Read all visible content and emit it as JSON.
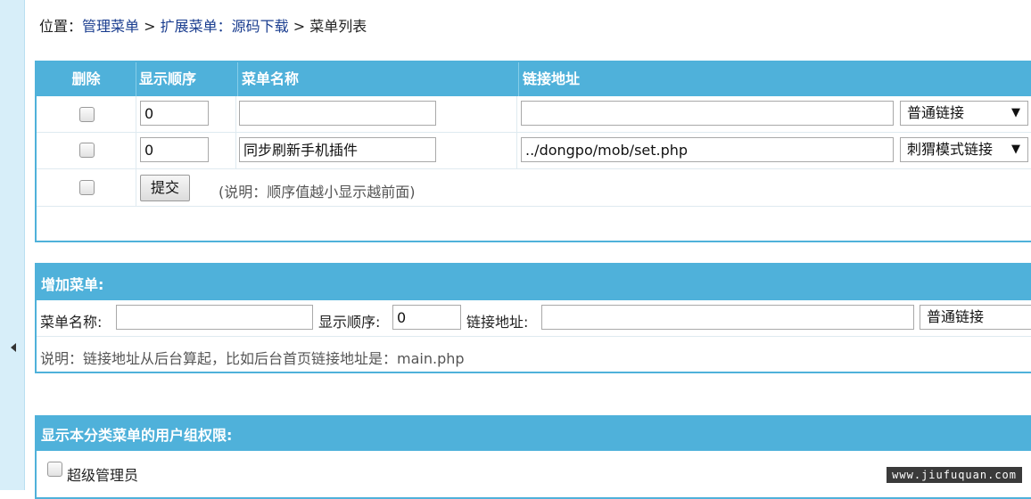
{
  "breadcrumb": {
    "prefix": "位置：",
    "item1": "管理菜单",
    "sep1": " > ",
    "item2": "扩展菜单：源码下载",
    "sep2": " > ",
    "current": "菜单列表"
  },
  "menu_table": {
    "headers": {
      "delete": "删除",
      "order": "显示顺序",
      "name": "菜单名称",
      "link": "链接地址"
    },
    "rows": [
      {
        "order": "0",
        "name": "",
        "link": "",
        "type": "普通链接"
      },
      {
        "order": "0",
        "name": "同步刷新手机插件",
        "link": "../dongpo/mob/set.php",
        "type": "刺猬模式链接"
      }
    ],
    "submit_label": "提交",
    "note": "(说明：顺序值越小显示越前面)"
  },
  "add_menu": {
    "title": "增加菜单:",
    "name_label": "菜单名称:",
    "name_value": "",
    "order_label": "显示顺序:",
    "order_value": "0",
    "link_label": "链接地址:",
    "link_value": "",
    "type_value": "普通链接",
    "note": "说明：链接地址从后台算起，比如后台首页链接地址是：main.php"
  },
  "permissions": {
    "title": "显示本分类菜单的用户组权限:",
    "groups": [
      {
        "label": "超级管理员",
        "checked": false
      }
    ]
  },
  "watermark": "www.jiufuquan.com",
  "colors": {
    "header_blue": "#4fb1da",
    "link_blue": "#1a3d8f"
  }
}
